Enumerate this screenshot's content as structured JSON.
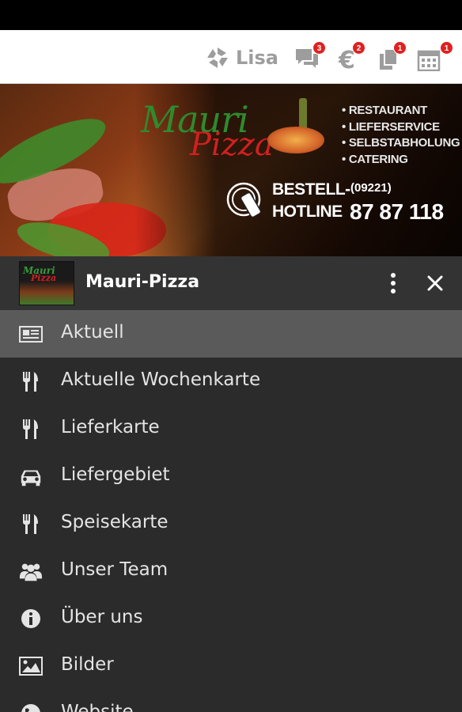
{
  "header": {
    "brand_label": "Lisa",
    "badges": {
      "messages": "3",
      "euro": "2",
      "documents": "1",
      "calendar": "1"
    }
  },
  "banner": {
    "logo_word1": "Mauri",
    "logo_word2": "Pizza",
    "services": [
      "RESTAURANT",
      "LIEFERSERVICE",
      "SELBSTABHOLUNG",
      "CATERING"
    ],
    "hotline_line1": "BESTELL-",
    "hotline_line2": "HOTLINE",
    "area_code": "(09221)",
    "phone_number": "87 87 118"
  },
  "drawer": {
    "title": "Mauri-Pizza",
    "thumb_word1": "Mauri",
    "thumb_word2": "Pizza"
  },
  "menu": {
    "items": [
      {
        "label": "Aktuell",
        "icon": "newspaper-icon"
      },
      {
        "label": "Aktuelle Wochenkarte",
        "icon": "cutlery-icon"
      },
      {
        "label": "Lieferkarte",
        "icon": "cutlery-icon"
      },
      {
        "label": "Liefergebiet",
        "icon": "car-icon"
      },
      {
        "label": "Speisekarte",
        "icon": "cutlery-icon"
      },
      {
        "label": "Unser Team",
        "icon": "group-icon"
      },
      {
        "label": "Über uns",
        "icon": "info-icon"
      },
      {
        "label": "Bilder",
        "icon": "image-icon"
      },
      {
        "label": "Website",
        "icon": "globe-icon"
      }
    ]
  },
  "colors": {
    "drawer_bg": "#2b2b2b",
    "drawer_header_bg": "#333333",
    "active_item_bg": "#5a5a5a",
    "badge_red": "#e02020",
    "topbar_icon_gray": "#9d9d9d"
  }
}
